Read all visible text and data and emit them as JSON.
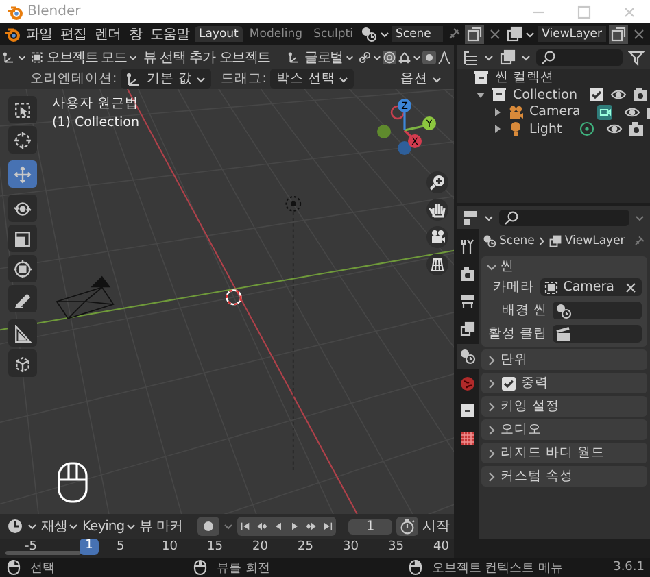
{
  "window": {
    "title": "Blender"
  },
  "menu": [
    "파일",
    "편집",
    "렌더",
    "창",
    "도움말"
  ],
  "workspaces": [
    {
      "label": "Layout",
      "selected": true
    },
    {
      "label": "Modeling",
      "selected": false
    },
    {
      "label": "Sculpti",
      "selected": false
    }
  ],
  "scene": "Scene",
  "view_layer": "ViewLayer",
  "viewport": {
    "mode": "오브젝트 모드",
    "menus": [
      "뷰",
      "선택",
      "추가",
      "오브젝트"
    ],
    "orientation": "글로벌",
    "settings": [
      {
        "label": "오리엔테이션:",
        "value": "기본 값"
      },
      {
        "label": "드래그:",
        "value": "박스 선택"
      }
    ],
    "options": "옵션",
    "view_name": "사용자 원근법",
    "collection": "(1) Collection",
    "tools": [
      {
        "kind": "select",
        "selected": false
      },
      {
        "kind": "cursor",
        "selected": false
      },
      {
        "kind": "move",
        "selected": true
      },
      {
        "kind": "rotate",
        "selected": false
      },
      {
        "kind": "scale",
        "selected": false
      },
      {
        "kind": "transform",
        "selected": false
      },
      {
        "kind": "annotate",
        "selected": false
      },
      {
        "kind": "measure",
        "selected": false
      },
      {
        "kind": "add",
        "selected": false
      }
    ],
    "gizmo": [
      "X",
      "Y",
      "Z"
    ]
  },
  "timeline": {
    "menus": [
      {
        "label": "재생",
        "dropdown": true
      },
      {
        "label": "Keying",
        "dropdown": true
      },
      {
        "label": "뷰",
        "dropdown": false
      },
      {
        "label": "마커",
        "dropdown": false
      }
    ],
    "frame": "1",
    "start": "시작",
    "current": "1",
    "ticks": [
      "-5",
      "5",
      "10",
      "15",
      "20",
      "25",
      "30",
      "35",
      "40"
    ]
  },
  "outliner": {
    "root": "씬 컬렉션",
    "items": [
      {
        "label": "Collection",
        "kind": "collection",
        "expanded": true,
        "checked": true,
        "children": [
          {
            "label": "Camera",
            "kind": "camera",
            "expanded": false
          },
          {
            "label": "Light",
            "kind": "light",
            "expanded": false
          }
        ]
      }
    ]
  },
  "properties": {
    "breadcrumb": [
      "Scene",
      "ViewLayer"
    ],
    "tabs": [
      {
        "kind": "tool",
        "selected": false
      },
      {
        "kind": "render",
        "selected": false
      },
      {
        "kind": "output",
        "selected": false
      },
      {
        "kind": "view_layer",
        "selected": false
      },
      {
        "kind": "scene",
        "selected": true
      },
      {
        "kind": "world",
        "selected": false
      },
      {
        "kind": "collection",
        "selected": false
      },
      {
        "kind": "texture",
        "selected": false
      }
    ],
    "panels": [
      {
        "title": "씬",
        "expanded": true,
        "fields": [
          {
            "label": "카메라",
            "kind": "object",
            "value": "Camera"
          },
          {
            "label": "배경 씬",
            "kind": "scene"
          },
          {
            "label": "활성 클립",
            "kind": "clip"
          }
        ]
      },
      {
        "title": "단위",
        "expanded": false
      },
      {
        "title": "중력",
        "expanded": false,
        "checked": true
      },
      {
        "title": "키잉 설정",
        "expanded": false
      },
      {
        "title": "오디오",
        "expanded": false
      },
      {
        "title": "리지드 바디 월드",
        "expanded": false
      },
      {
        "title": "커스텀 속성",
        "expanded": false
      }
    ]
  },
  "status_bar": {
    "hints": [
      {
        "kind": "left",
        "label": "선택"
      },
      {
        "kind": "middle",
        "label": "뷰를 회전"
      },
      {
        "kind": "right",
        "label": "오브젝트 컨텍스트 메뉴"
      }
    ],
    "version": "3.6.1"
  }
}
